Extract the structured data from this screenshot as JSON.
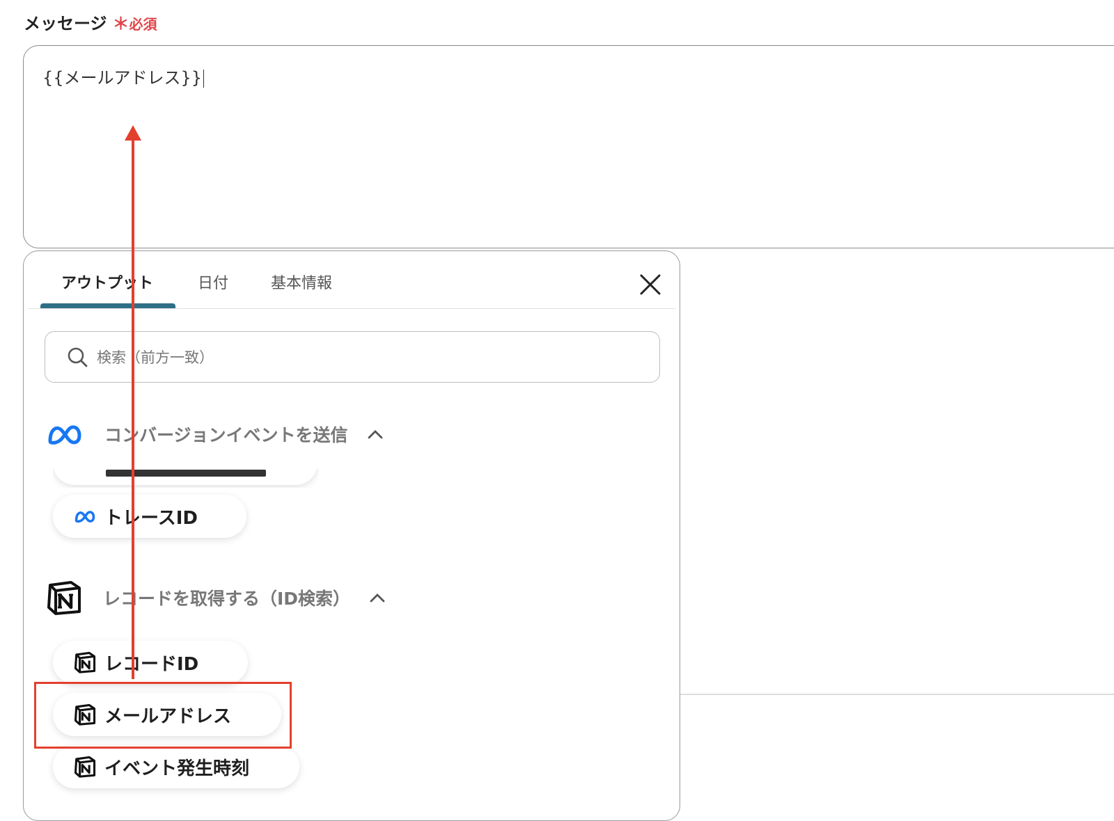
{
  "field": {
    "label": "メッセージ",
    "required_mark": "＊",
    "required_text": "必須",
    "value": "{{メールアドレス}}"
  },
  "popup": {
    "tabs": [
      {
        "label": "アウトプット",
        "active": true
      },
      {
        "label": "日付",
        "active": false
      },
      {
        "label": "基本情報",
        "active": false
      }
    ],
    "search": {
      "placeholder": "検索（前方一致）",
      "value": ""
    },
    "sections": [
      {
        "title": "コンバージョンイベントを送信",
        "icon": "meta-logo-icon",
        "items": [
          "トレースID"
        ]
      },
      {
        "title": "レコードを取得する（ID検索）",
        "icon": "notion-logo-icon",
        "items": [
          "レコードID",
          "メールアドレス",
          "イベント発生時刻"
        ]
      }
    ]
  },
  "colors": {
    "accent_tab": "#2f6f86",
    "required": "#e0454a",
    "annotation": "#e2402d",
    "meta_blue": "#1877f2"
  }
}
